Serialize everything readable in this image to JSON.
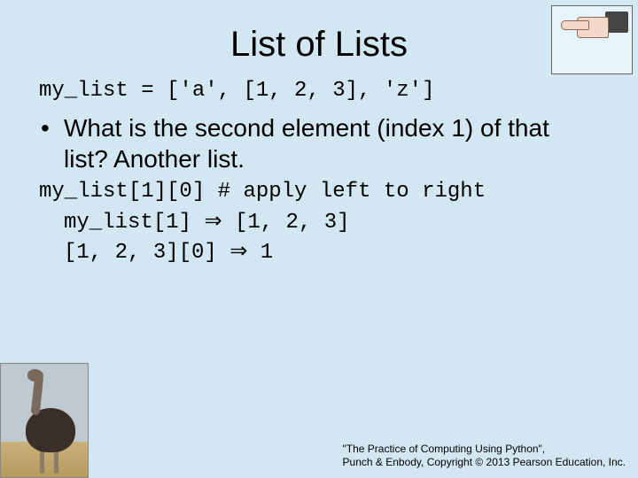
{
  "title": "List of Lists",
  "code_decl": "my_list = ['a', [1, 2, 3], 'z']",
  "bullet": "What is the second element (index 1) of that list? Another list.",
  "line1_a": "my_list[1][0] ",
  "line1_b": "# apply left to right",
  "line2_a": "my_list[1] ",
  "line2_b": " [1, 2, 3]",
  "line3_a": "[1, 2, 3][0] ",
  "line3_b": " 1",
  "arrow": "⇒",
  "credit_line1": "\"The Practice of Computing Using Python\",",
  "credit_line2": "Punch & Enbody, Copyright © 2013 Pearson Education, Inc.",
  "icons": {
    "hand": "pointing-hand-image",
    "ostrich": "ostrich-image"
  }
}
